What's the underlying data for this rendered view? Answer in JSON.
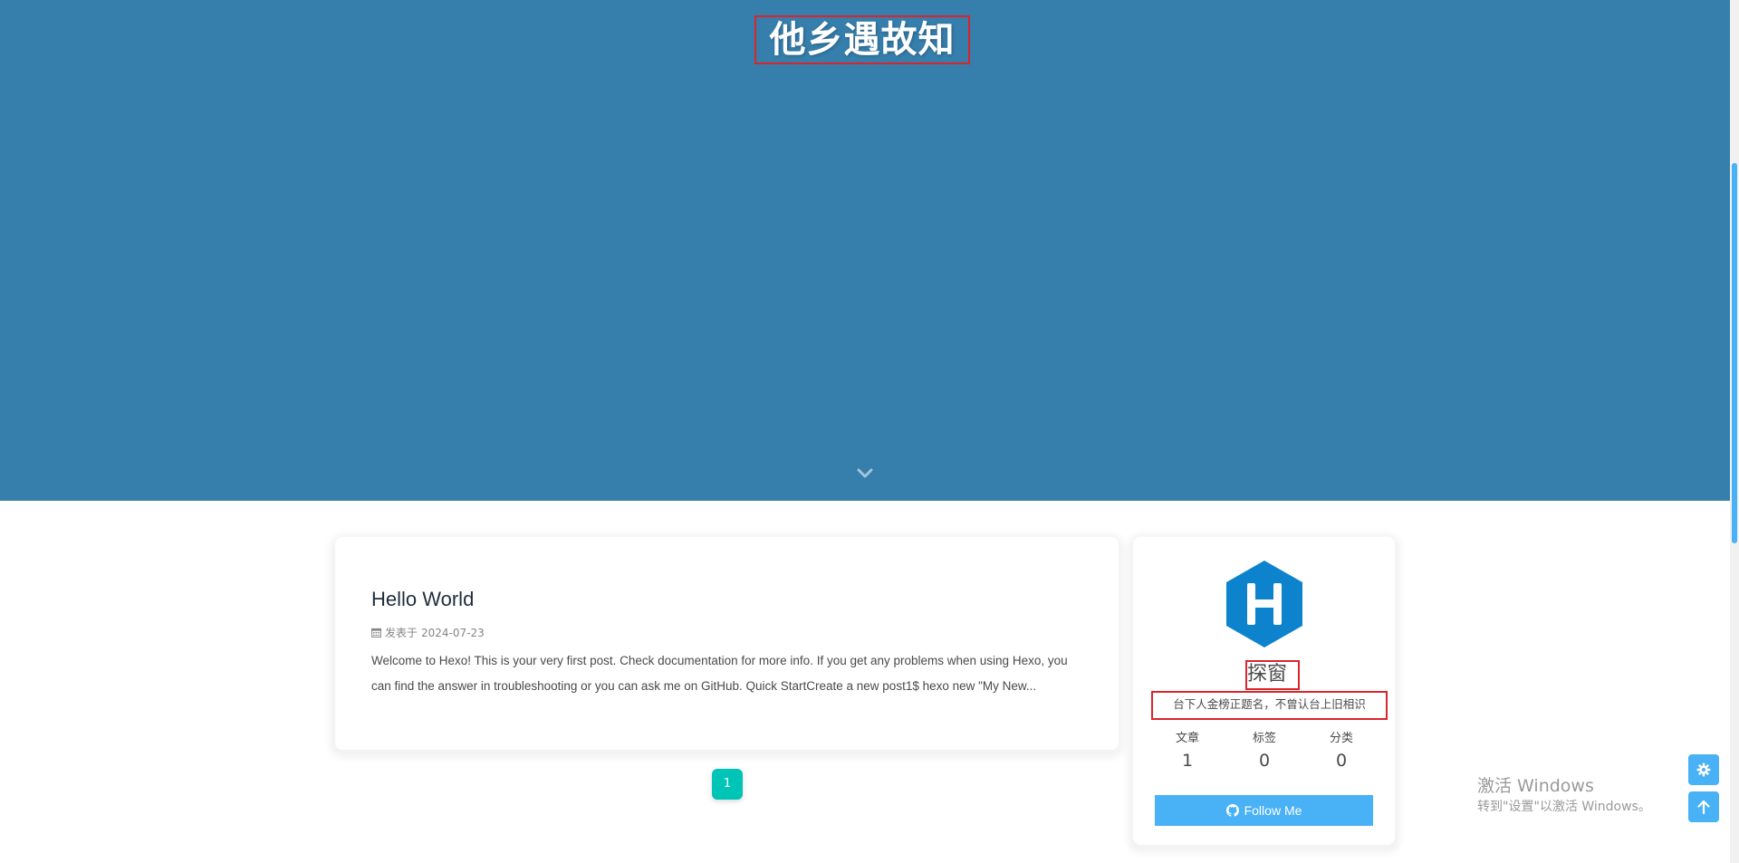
{
  "site": {
    "title": "他乡遇故知",
    "hero_color": "#367eac"
  },
  "post": {
    "title": "Hello World",
    "meta_prefix": "发表于",
    "date": "2024-07-23",
    "excerpt": "Welcome to Hexo! This is your very first post. Check documentation for more info. If you get any problems when using Hexo, you can find the answer in troubleshooting or you can ask me on GitHub. Quick StartCreate a new post1$ hexo new \"My New..."
  },
  "pagination": {
    "current_page": "1"
  },
  "author": {
    "name": "探窗",
    "description": "台下人金榜正题名，不曾认台上旧相识",
    "stats": [
      {
        "label": "文章",
        "value": "1"
      },
      {
        "label": "标签",
        "value": "0"
      },
      {
        "label": "分类",
        "value": "0"
      }
    ],
    "follow_label": "Follow Me",
    "avatar_icon": "hexo-logo-icon",
    "accent_color": "#49b1f5"
  },
  "watermark": {
    "title": "激活 Windows",
    "subtitle": "转到\"设置\"以激活 Windows。"
  },
  "icons": {
    "scroll_down": "chevron-down-icon",
    "calendar": "calendar-icon",
    "github": "github-icon",
    "settings": "gear-icon",
    "back_to_top": "arrow-up-icon"
  }
}
